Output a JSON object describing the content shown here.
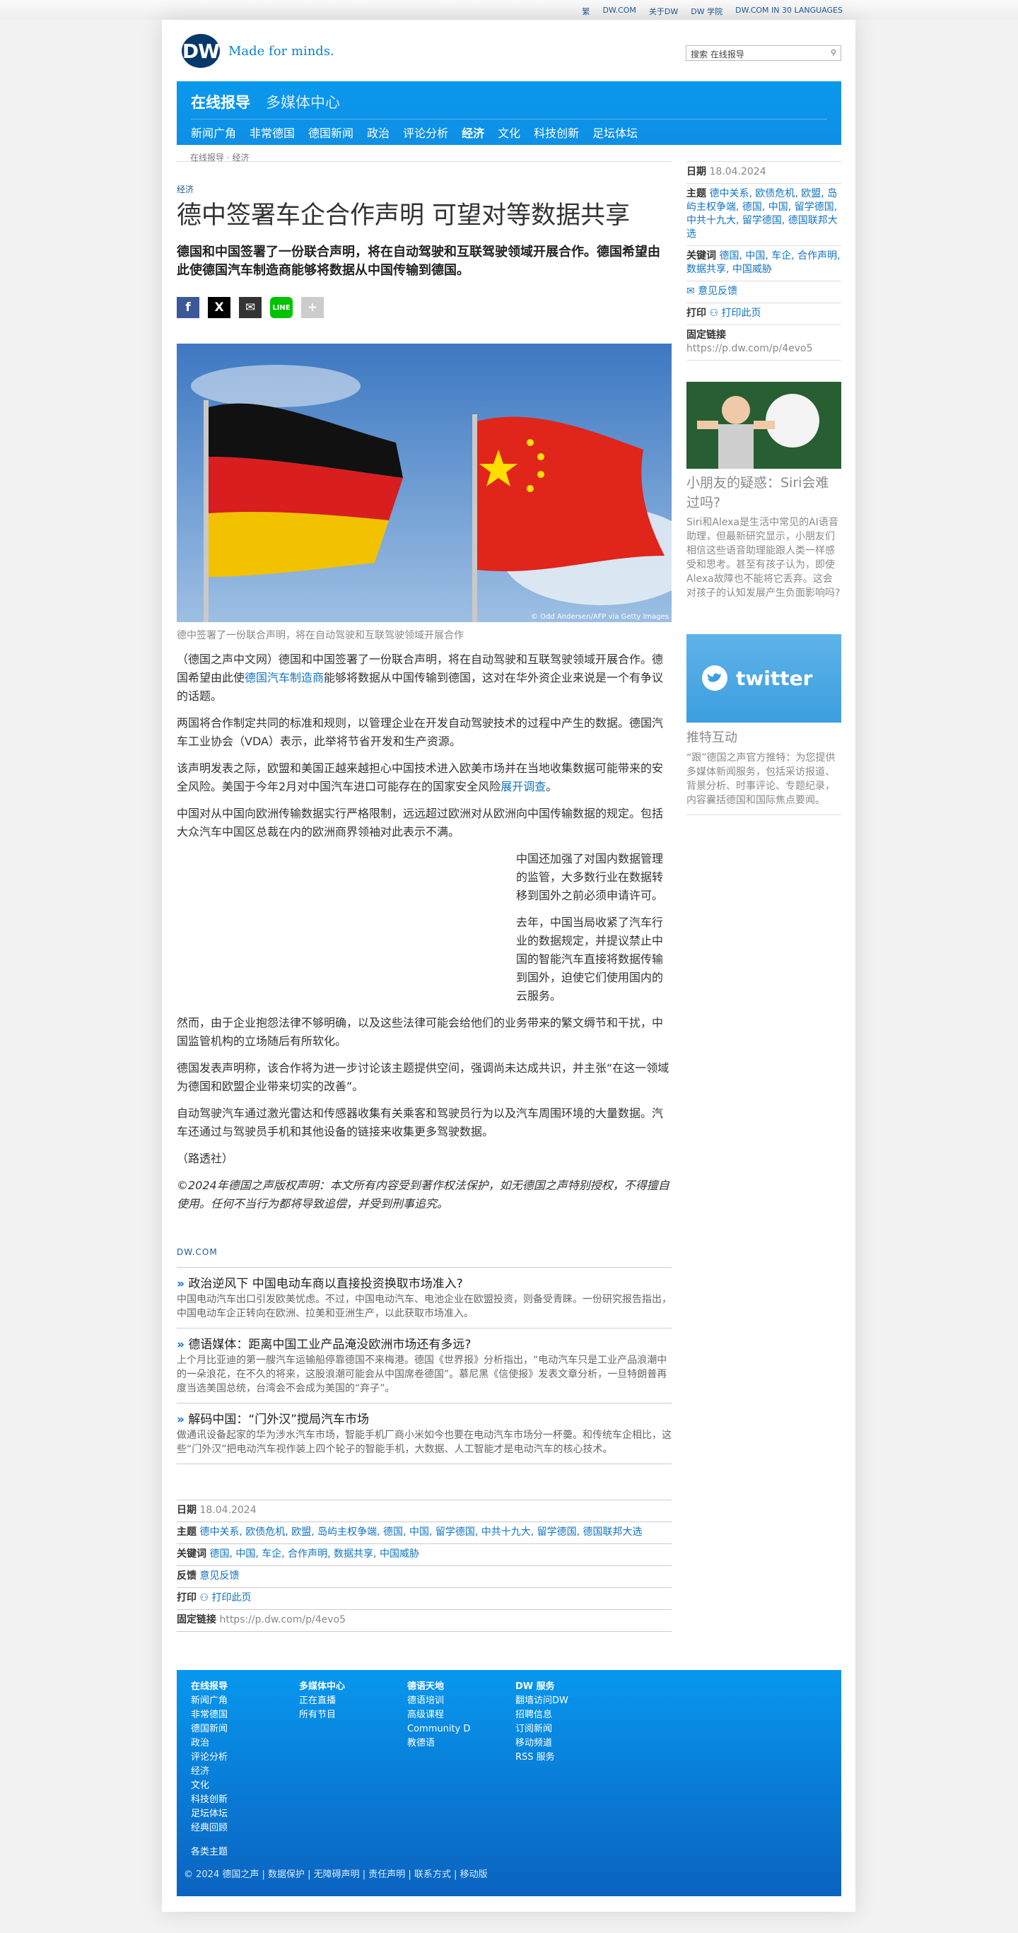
{
  "toplinks": [
    "繁",
    "DW.COM",
    "关于DW",
    "DW 学院",
    "DW.COM IN 30 LANGUAGES"
  ],
  "brand": {
    "logo": "DW",
    "tagline": "Made for minds."
  },
  "search": {
    "value": "搜索 在线报导"
  },
  "nav": {
    "primary": "在线报导",
    "secondary": "多媒体中心",
    "sub": [
      "新闻广角",
      "非常德国",
      "德国新闻",
      "政治",
      "评论分析",
      "经济",
      "文化",
      "科技创新",
      "足坛体坛"
    ],
    "active": "经济"
  },
  "breadcrumb": "在线报导 · 经济",
  "article": {
    "kicker": "经济",
    "title": "德中签署车企合作声明 可望对等数据共享",
    "lead": "德国和中国签署了一份联合声明，将在自动驾驶和互联驾驶领域开展合作。德国希望由此使德国汽车制造商能够将数据从中国传输到德国。",
    "photo_credit": "© Odd Andersen/AFP via Getty Images",
    "caption": "德中签署了一份联合声明，将在自动驾驶和互联驾驶领域开展合作",
    "p1a": "（德国之声中文网）德国和中国签署了一份联合声明，将在自动驾驶和互联驾驶领域开展合作。德国希望由此使",
    "p1link": "德国汽车制造商",
    "p1b": "能够将数据从中国传输到德国，这对在华外资企业来说是一个有争议的话题。",
    "p2": "两国将合作制定共同的标准和规则，以管理企业在开发自动驾驶技术的过程中产生的数据。德国汽车工业协会（VDA）表示，此举将节省开发和生产资源。",
    "p3a": "该声明发表之际，欧盟和美国正越来越担心中国技术进入欧美市场并在当地收集数据可能带来的安全风险。美国于今年2月对中国汽车进口可能存在的国家安全风险",
    "p3link": "展开调查",
    "p3b": "。",
    "p4": "中国对从中国向欧洲传输数据实行严格限制，远远超过欧洲对从欧洲向中国传输数据的规定。包括大众汽车中国区总裁在内的欧洲商界领袖对此表示不满。",
    "p5": "中国还加强了对国内数据管理的监管，大多数行业在数据转移到国外之前必须申请许可。",
    "p6": "去年，中国当局收紧了汽车行业的数据规定，并提议禁止中国的智能汽车直接将数据传输到国外，迫使它们使用国内的云服务。",
    "p7": "然而，由于企业抱怨法律不够明确，以及这些法律可能会给他们的业务带来的繁文缛节和干扰，中国监管机构的立场随后有所软化。",
    "p8": "德国发表声明称，该合作将为进一步讨论该主题提供空间，强调尚未达成共识，并主张“在这一领域为德国和欧盟企业带来切实的改善”。",
    "p9": "自动驾驶汽车通过激光雷达和传感器收集有关乘客和驾驶员行为以及汽车周围环境的大量数据。汽车还通过与驾驶员手机和其他设备的链接来收集更多驾驶数据。",
    "p10": "（路透社）",
    "copyright": "©2024年德国之声版权声明：本文所有内容受到著作权法保护，如无德国之声特别授权，不得擅自使用。任何不当行为都将导致追偿，并受到刑事追究。"
  },
  "related": {
    "label": "DW.COM",
    "items": [
      {
        "title": "政治逆风下 中国电动车商以直接投资换取市场准入?",
        "text": "中国电动汽车出口引发欧美忧虑。不过，中国电动汽车、电池企业在欧盟投资，则备受青睐。一份研究报告指出，中国电动车企正转向在欧洲、拉美和亚洲生产，以此获取市场准入。"
      },
      {
        "title": "德语媒体：距离中国工业产品淹没欧洲市场还有多远?",
        "text": "上个月比亚迪的第一艘汽车运输船停靠德国不来梅港。德国《世界报》分析指出，“电动汽车只是工业产品浪潮中的一朵浪花，在不久的将来，这股浪潮可能会从中国席卷德国”。慕尼黑《信使报》发表文章分析，一旦特朗普再度当选美国总统，台湾会不会成为美国的“弃子”。"
      },
      {
        "title": "解码中国：“门外汉”搅局汽车市场",
        "text": "做通讯设备起家的华为涉水汽车市场，智能手机厂商小米如今也要在电动汽车市场分一杯羹。和传统车企相比，这些“门外汉”把电动汽车视作装上四个轮子的智能手机，大数据、人工智能才是电动汽车的核心技术。"
      }
    ]
  },
  "meta": {
    "date_label": "日期",
    "date": "18.04.2024",
    "topics_label": "主题",
    "topics": "德中关系, 欧债危机, 欧盟, 岛屿主权争端, 德国, 中国, 留学德国, 中共十九大, 留学德国, 德国联邦大选",
    "keywords_label": "关键词",
    "keywords": "德国, 中国, 车企, 合作声明, 数据共享, 中国威胁",
    "feedback_label": "反馈",
    "feedback": "意见反馈",
    "print_label": "打印",
    "print": "打印此页",
    "permalink_label": "固定链接",
    "permalink": "https://p.dw.com/p/4evo5"
  },
  "sidebar": {
    "date_label": "日期",
    "date": "18.04.2024",
    "topics_label": "主题",
    "topics": "德中关系, 欧债危机, 欧盟, 岛屿主权争端, 德国, 中国, 留学德国, 中共十九大, 留学德国, 德国联邦大选",
    "keywords_label": "关键词",
    "keywords": "德国, 中国, 车企, 合作声明, 数据共享, 中国威胁",
    "feedback": "意见反馈",
    "print_label": "打印",
    "print": "打印此页",
    "permalink_label": "固定链接",
    "permalink": "https://p.dw.com/p/4evo5",
    "teaser_title": "小朋友的疑惑：Siri会难过吗?",
    "teaser_text": "Siri和Alexa是生活中常见的AI语音助理，但最新研究显示，小朋友们相信这些语音助理能跟人类一样感受和思考。甚至有孩子认为，即使Alexa故障也不能将它丢弃。这会对孩子的认知发展产生负面影响吗?",
    "twitter_label": "twitter",
    "tw_title": "推特互动",
    "tw_text": "“跟”德国之声官方推特：为您提供多媒体新闻服务，包括采访报道、背景分析、时事评论、专题纪录，内容囊括德国和国际焦点要闻。"
  },
  "footer": {
    "cols": [
      {
        "h": "在线报导",
        "items": [
          "新闻广角",
          "非常德国",
          "德国新闻",
          "政治",
          "评论分析",
          "经济",
          "文化",
          "科技创新",
          "足坛体坛",
          "经典回顾"
        ]
      },
      {
        "h": "多媒体中心",
        "items": [
          "正在直播",
          "所有节目"
        ]
      },
      {
        "h": "德语天地",
        "items": [
          "德语培训",
          "高级课程",
          "Community D",
          "教德语"
        ]
      },
      {
        "h": "DW 服务",
        "items": [
          "翻墙访问DW",
          "招聘信息",
          "订阅新闻",
          "移动频道",
          "RSS 服务"
        ]
      }
    ],
    "topics": "各类主题",
    "bottom": "© 2024 德国之声 | 数据保护 | 无障碍声明 | 责任声明 | 联系方式 | 移动版"
  }
}
